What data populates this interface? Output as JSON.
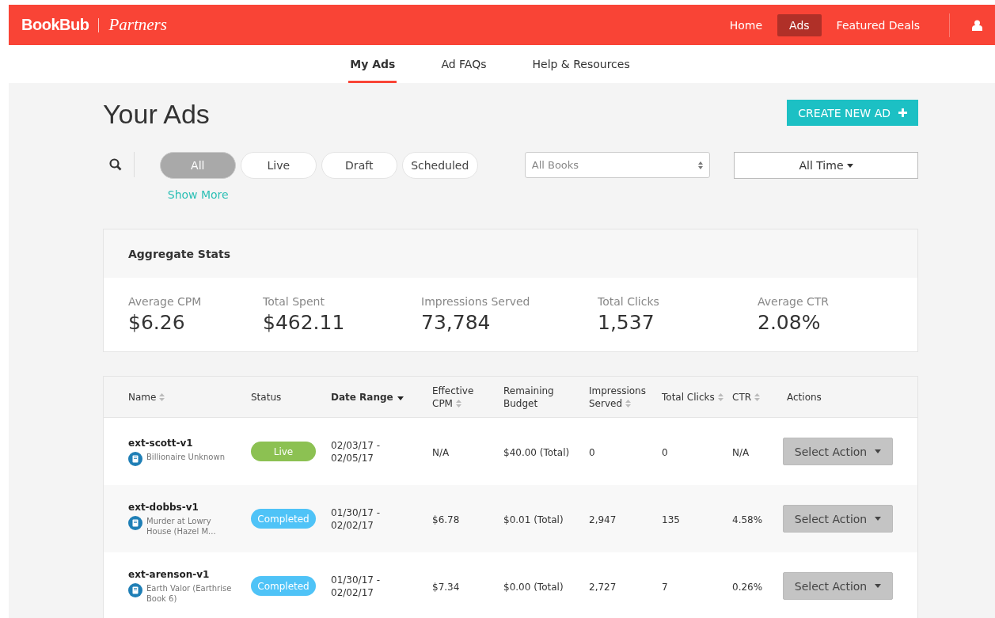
{
  "brand": {
    "name": "BookBub",
    "sub": "Partners"
  },
  "top_nav": [
    {
      "label": "Home",
      "selected": false
    },
    {
      "label": "Ads",
      "selected": true
    },
    {
      "label": "Featured Deals",
      "selected": false
    }
  ],
  "sub_nav": [
    {
      "label": "My Ads",
      "selected": true
    },
    {
      "label": "Ad FAQs",
      "selected": false
    },
    {
      "label": "Help & Resources",
      "selected": false
    }
  ],
  "page_title": "Your Ads",
  "create_button": "CREATE NEW AD",
  "filters": [
    {
      "label": "All",
      "selected": true
    },
    {
      "label": "Live",
      "selected": false
    },
    {
      "label": "Draft",
      "selected": false
    },
    {
      "label": "Scheduled",
      "selected": false
    }
  ],
  "show_more": "Show More",
  "books_select": {
    "placeholder": "All Books"
  },
  "time_select": {
    "value": "All Time"
  },
  "aggregate": {
    "title": "Aggregate Stats",
    "stats": [
      {
        "label": "Average CPM",
        "value": "$6.26"
      },
      {
        "label": "Total Spent",
        "value": "$462.11"
      },
      {
        "label": "Impressions Served",
        "value": "73,784"
      },
      {
        "label": "Total Clicks",
        "value": "1,537"
      },
      {
        "label": "Average CTR",
        "value": "2.08%"
      }
    ]
  },
  "table": {
    "columns": [
      {
        "label": "Name",
        "sortable": true,
        "sorted": false
      },
      {
        "label": "Status",
        "sortable": false,
        "sorted": false
      },
      {
        "label": "Date Range",
        "sortable": true,
        "sorted": true
      },
      {
        "label": "Effective CPM",
        "sortable": true,
        "sorted": false
      },
      {
        "label": "Remaining Budget",
        "sortable": false,
        "sorted": false
      },
      {
        "label": "Impressions Served",
        "sortable": true,
        "sorted": false
      },
      {
        "label": "Total Clicks",
        "sortable": true,
        "sorted": false
      },
      {
        "label": "CTR",
        "sortable": true,
        "sorted": false
      },
      {
        "label": "Actions",
        "sortable": false,
        "sorted": false
      }
    ],
    "rows": [
      {
        "name": "ext-scott-v1",
        "book": "Billionaire Unknown",
        "status": "Live",
        "color": "#8cc152",
        "date_start": "02/03/17 -",
        "date_end": "02/05/17",
        "cpm": "N/A",
        "budget": "$40.00 (Total)",
        "impressions": "0",
        "clicks": "0",
        "ctr": "N/A",
        "action": "Select Action"
      },
      {
        "name": "ext-dobbs-v1",
        "book": "Murder at Lowry House (Hazel M...",
        "status": "Completed",
        "color": "#4fc3f7",
        "date_start": "01/30/17 -",
        "date_end": "02/02/17",
        "cpm": "$6.78",
        "budget": "$0.01 (Total)",
        "impressions": "2,947",
        "clicks": "135",
        "ctr": "4.58%",
        "action": "Select Action"
      },
      {
        "name": "ext-arenson-v1",
        "book": "Earth Valor (Earthrise Book 6)",
        "status": "Completed",
        "color": "#4fc3f7",
        "date_start": "01/30/17 -",
        "date_end": "02/02/17",
        "cpm": "$7.34",
        "budget": "$0.00 (Total)",
        "impressions": "2,727",
        "clicks": "7",
        "ctr": "0.26%",
        "action": "Select Action"
      }
    ]
  }
}
